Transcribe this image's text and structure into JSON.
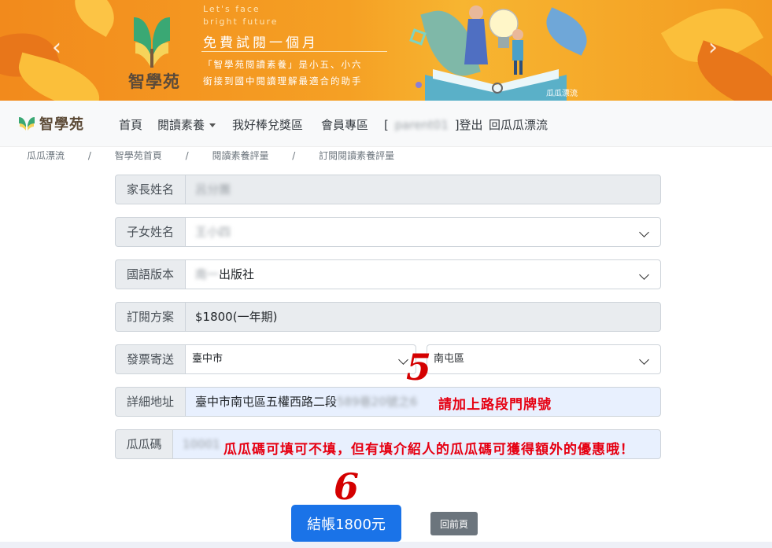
{
  "banner": {
    "tagline_line1": "Let's face",
    "tagline_line2": "bright future",
    "title": "免費試閱一個月",
    "desc_line1": "「智學苑閱讀素養」是小五、小六",
    "desc_line2": "銜接到國中閱讀理解最適合的助手",
    "logo_text": "智學苑",
    "source_tag": "瓜瓜漂流",
    "prev_arrow": "‹",
    "next_arrow": "›"
  },
  "navbar": {
    "brand": "智學苑",
    "items": [
      "首頁",
      "閱讀素養",
      "我好棒兌獎區",
      "會員專區"
    ],
    "user_open": "[",
    "username": "parent01",
    "logout": "]登出",
    "back_link": "回瓜瓜漂流"
  },
  "breadcrumb": {
    "items": [
      "瓜瓜漂流",
      "智學苑首頁",
      "閱讀素養評量",
      "訂閱閱讀素養評量"
    ],
    "separator": "/"
  },
  "form": {
    "parent_name": {
      "label": "家長姓名",
      "value": "呂分團"
    },
    "child_name": {
      "label": "子女姓名",
      "value": "王小四"
    },
    "edition": {
      "label": "國語版本",
      "value_blur": "南一",
      "value": "出版社"
    },
    "plan": {
      "label": "訂閱方案",
      "value": "$1800(一年期)"
    },
    "invoice": {
      "label": "發票寄送",
      "city": "臺中市",
      "district": "南屯區"
    },
    "address": {
      "label": "詳細地址",
      "value": "臺中市南屯區五權西路二段",
      "value_blur": "589巷20號之6"
    },
    "melon_code": {
      "label": "瓜瓜碼",
      "value": "10001"
    }
  },
  "annotations": {
    "step5": "5",
    "address_hint": "請加上路段門牌號",
    "code_hint": "瓜瓜碼可填可不填，但有填介紹人的瓜瓜碼可獲得額外的優惠哦！",
    "step6": "6"
  },
  "actions": {
    "checkout": "結帳1800元",
    "back": "回前頁"
  },
  "colors": {
    "banner_orange": "#f39a20",
    "primary": "#1a73e8",
    "secondary": "#6c757d",
    "annotation_red": "#e60012"
  }
}
